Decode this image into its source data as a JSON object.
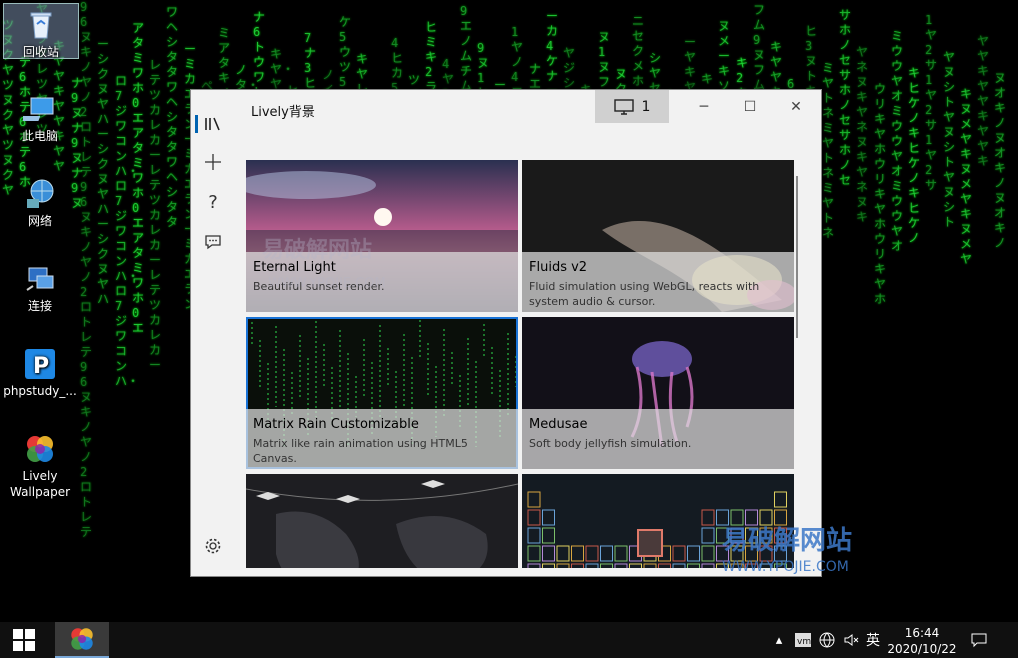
{
  "desktop": {
    "icons": [
      {
        "label": "回收站"
      },
      {
        "label": "此电脑"
      },
      {
        "label": "网络"
      },
      {
        "label": "连接"
      },
      {
        "label": "phpstudy_..."
      },
      {
        "label": "Lively Wallpaper"
      }
    ],
    "matrix_columns": [
      "96ヌキノヤノ2ロトレテ",
      "ーシクヌヤハ",
      "ロ7ジワコンハ・",
      "アタミワホ0エ",
      "レテツカレカー",
      "ワヘシタタ",
      "ーミカエラン",
      "ペナクレヌキ",
      "ミアタキメナ",
      "ノタ・エンテ",
      "ナ6トウワレ",
      "キヤ・ヤレン",
      "ヒ1ソケンス",
      "7ナ3ヒキツ",
      "ノイ=ハホロ",
      "ケ5ウツ5",
      "キヤレレカ",
      "ツハエラリカ",
      "4ヒカ5オエ",
      "ツチサ9ツヒ",
      "ヒミキ2ラキ",
      "4ヤ2ミラー",
      "9エノムチム",
      "9ヌ1ヒ4ネ",
      "ーヤ4エエム",
      "1ヤノ4エヒ",
      "ナエ3ヌ3ク",
      "ーカ4ケナ",
      "ヤジシレ5ロ",
      "キ1ト5ヌセ",
      "ヌ1ヌフト",
      "ヌクテ6ン",
      "ニセクメホ",
      "シヤセ9ホ",
      "ヒハレコハメ",
      "ーヤキヤ",
      "キ=ウ5ト",
      "ヌメーキソ",
      "キ2キヌナ",
      "フム9ヌ",
      "キヤヤ",
      "6エノキ",
      "ヒ3ヌトキ",
      "ミヤトネ",
      "サホノセ",
      "ヤネヌキ",
      "ウリキヤホ",
      "ミウウヤオ",
      "キヒケノ",
      "1ヤ2サ",
      "ヤヌシト",
      "キヌメヤ",
      "ヤヤキ",
      "ヌオキノ",
      "ツヌクヤ",
      "テ6ホ",
      "ヤレツ",
      "キヤヤ",
      "ナ9ヌ"
    ]
  },
  "window": {
    "title": "Lively背景",
    "screen_label": "1",
    "nav": [
      "library-icon",
      "add-icon",
      "help-icon",
      "feedback-icon",
      "settings-icon"
    ],
    "wallpapers": [
      {
        "title": "Eternal Light",
        "desc": "Beautiful sunset render."
      },
      {
        "title": "Fluids v2",
        "desc": "Fluid simulation using WebGL, reacts with system audio & cursor."
      },
      {
        "title": "Matrix Rain Customizable",
        "desc": "Matrix like rain animation using HTML5 Canvas."
      },
      {
        "title": "Medusae",
        "desc": "Soft body jellyfish simulation."
      },
      {
        "title": "",
        "desc": ""
      },
      {
        "title": "",
        "desc": ""
      }
    ]
  },
  "taskbar": {
    "time": "16:44",
    "date": "2020/10/22",
    "ime": "英"
  },
  "watermarks": {
    "wm1": "易破解网站",
    "wm2": "WWW.YPOJIE.COM",
    "wm3": "易破解网站",
    "wm4": "WWW.YPOJIE.COM"
  },
  "colors": {
    "accent": "#1a73d6",
    "matrix_green": "#1fd33a"
  }
}
